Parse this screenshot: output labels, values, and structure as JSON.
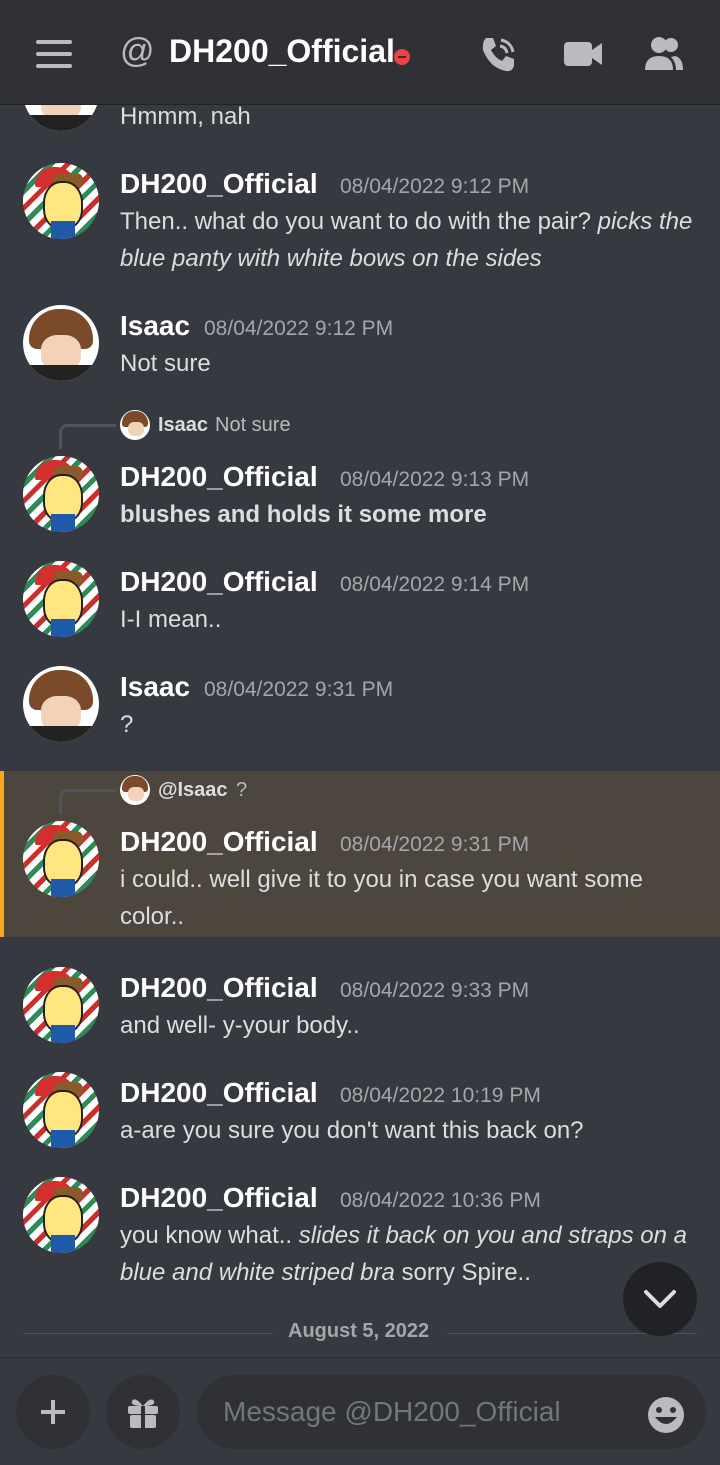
{
  "header": {
    "at_symbol": "@",
    "title": "DH200_Official"
  },
  "messages": [
    {
      "name": "",
      "time": "",
      "text": "Hmmm, nah"
    },
    {
      "name": "DH200_Official",
      "time": "08/04/2022 9:12 PM",
      "text": "Then.. what do you want to do with the pair?",
      "italic": "picks the blue panty with white bows on the sides"
    },
    {
      "name": "Isaac",
      "time": "08/04/2022 9:12 PM",
      "text": "Not sure"
    },
    {
      "name": "DH200_Official",
      "time": "08/04/2022 9:13 PM",
      "text": "blushes and holds it some more",
      "reply": {
        "name": "Isaac",
        "text": "Not sure"
      }
    },
    {
      "name": "DH200_Official",
      "time": "08/04/2022 9:14 PM",
      "text": "I-I mean.."
    },
    {
      "name": "Isaac",
      "time": "08/04/2022 9:31 PM",
      "text": "?"
    },
    {
      "name": "DH200_Official",
      "time": "08/04/2022 9:31 PM",
      "text": "i could.. well give it to you in case you want some color..",
      "reply": {
        "name": "@Isaac",
        "text": "?"
      }
    },
    {
      "name": "DH200_Official",
      "time": "08/04/2022 9:33 PM",
      "text": "and well- y-your body.."
    },
    {
      "name": "DH200_Official",
      "time": "08/04/2022 10:19 PM",
      "text": "a-are you sure you don't want this back on?"
    },
    {
      "name": "DH200_Official",
      "time": "08/04/2022 10:36 PM",
      "text": "you know what..",
      "italic": "slides it back on you and straps on a blue and white striped bra",
      "tail": "sorry Spire.."
    }
  ],
  "date_divider": "August 5, 2022",
  "composer": {
    "placeholder": "Message @DH200_Official"
  },
  "colors": {
    "background": "#36393f",
    "header": "#2f3136",
    "highlight": "#4c463f",
    "mention_bar": "#faa81a",
    "dnd_status": "#ed4245"
  }
}
